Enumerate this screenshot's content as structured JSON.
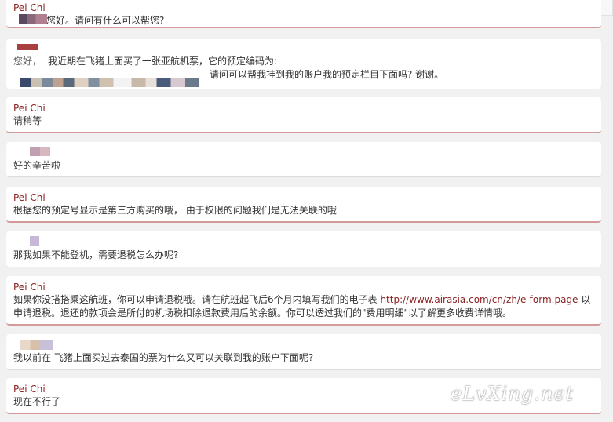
{
  "messages": [
    {
      "role": "agent",
      "name": "Pei Chi",
      "text": "您好。请问有什么可以帮您?"
    },
    {
      "role": "user",
      "lead": "您好，",
      "text1": "我近期在飞猪上面买了一张亚航机票，它的预定编码为:",
      "text2": "请问可以帮我挂到我的账户我的预定栏目下面吗? 谢谢。"
    },
    {
      "role": "agent",
      "name": "Pei Chi",
      "text": "请稍等"
    },
    {
      "role": "user",
      "text": "好的辛苦啦"
    },
    {
      "role": "agent",
      "name": "Pei Chi",
      "text": "根据您的预定号显示是第三方购买的哦， 由于权限的问题我们是无法关联的哦"
    },
    {
      "role": "user",
      "text": "那我如果不能登机，需要退税怎么办呢?"
    },
    {
      "role": "agent",
      "name": "Pei Chi",
      "text_before": "如果你没搭搭乘这航班，你可以申请退税哦。请在航班起飞后6个月内填写我们的电子表 ",
      "link": "http://www.airasia.com/cn/zh/e-form.page",
      "text_after": " 以申请退税。退还的款项会是所付的机场税扣除退款费用后的余额。你可以透过我们的\"费用明细\"以了解更多收费详情哦。"
    },
    {
      "role": "user",
      "text": "我以前在 飞猪上面买过去泰国的票为什么又可以关联到我的账户下面呢?"
    },
    {
      "role": "agent",
      "name": "Pei Chi",
      "text": "现在不行了"
    }
  ],
  "watermark": "eLvXing.net",
  "colors": {
    "agent_name": "#8a2222",
    "agent_border": "#d49a9a",
    "link": "#8a2222"
  }
}
